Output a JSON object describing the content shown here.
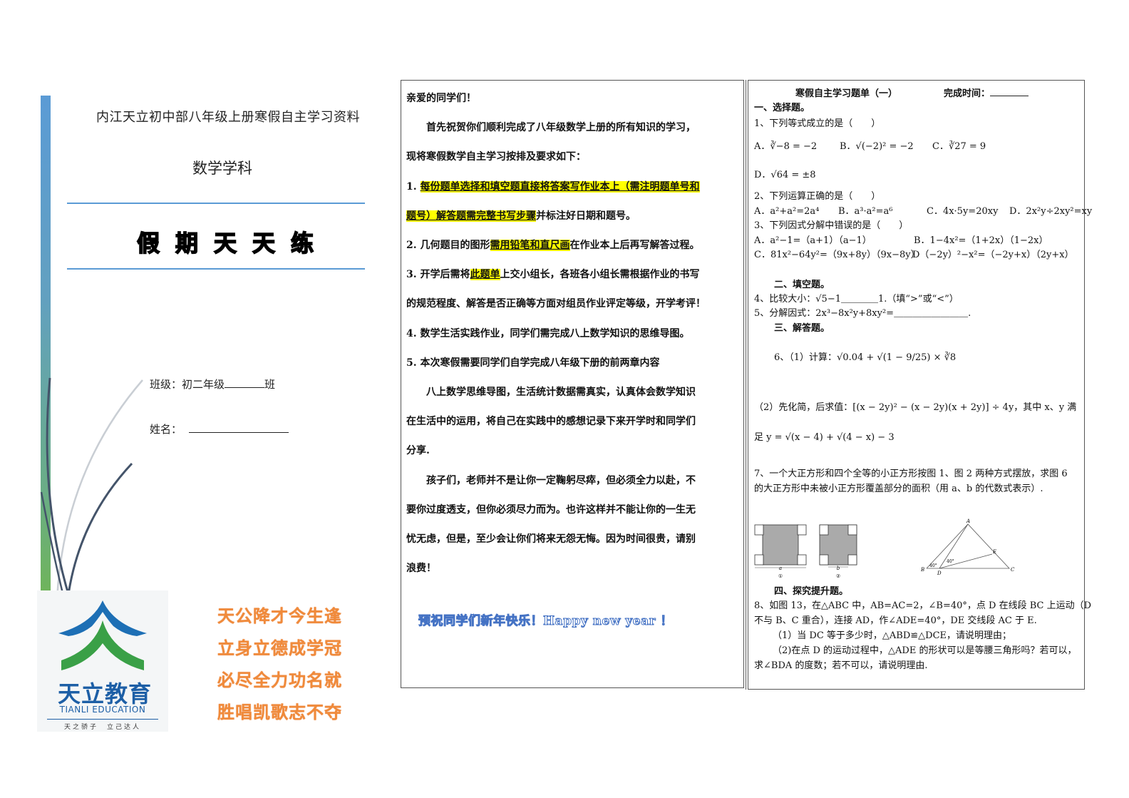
{
  "cover": {
    "title": "内江天立初中部八年级上册寒假自主学习资料",
    "subject": "数学学科",
    "banner": "假期天天练",
    "class_label": "班级：初二年级",
    "class_suffix": "班",
    "name_label": "姓名：",
    "logo": {
      "cn": "天立教育",
      "en": "TIANLI EDUCATION",
      "motto": "天之骄子　立己达人",
      "brand_blue": "#1d5fa6",
      "brand_green": "#3a9a3a"
    },
    "poem": [
      "天公降才今生逢",
      "立身立德成学冠",
      "必尽全力功名就",
      "胜唱凯歌志不夺"
    ],
    "poem_color": "#f08a3a"
  },
  "letter": {
    "salutation": "亲爱的同学们！",
    "intro_1": "首先祝贺你们顺利完成了八年级数学上册的所有知识的学习，",
    "intro_2": "现将寒假数学自主学习按排及要求如下：",
    "item1_num": "1. ",
    "item1_hl1": "每份题单选择和填空题直接将答案写作业本上（需注明题单号和",
    "item1_hl2": "题号）解答题需完整书写步骤",
    "item1_rest": "并标注好日期和题号。",
    "item2_pre": "2. 几何题目的图形",
    "item2_hl": "需用铅笔和直尺画",
    "item2_rest": "在作业本上后再写解答过程。",
    "item3_pre": "3. 开学后需将",
    "item3_hl": "此题单",
    "item3_rest": "上交小组长，各班各小组长需根据作业的书写",
    "item3_line2": "的规范程度、解答是否正确等方面对组员作业评定等级，开学考评！",
    "item4": "4. 数学生活实践作业，同学们需完成八上数学知识的思维导图。",
    "item5": "5. 本次寒假需要同学们自学完成八年级下册的前两章内容",
    "para2_1": "八上数学思维导图，生活统计数据需真实，认真体会数学知识",
    "para2_2": "在生活中的运用，将自己在实践中的感想记录下来开学时和同学们",
    "para2_3": "分享.",
    "para3_1": "孩子们，老师并不是让你一定鞠躬尽瘁，但必须全力以赴，不",
    "para3_2": "要你过度透支，但你必须尽力而为。也许这样并不能让你的一生无",
    "para3_3": "忧无虑，但是，至少会让你们将来无怨无悔。因为时间很贵，请别",
    "para3_4": "浪费！",
    "greeting": "预祝同学们新年快乐！Happy  new  year  ！",
    "highlight_color": "#ffff00",
    "greeting_color": "#4472c4"
  },
  "sheet": {
    "title": "寒假自主学习题单（一）",
    "time_label": "完成时间：",
    "sec1": "一、选择题。",
    "q1": "1、下列等式成立的是（　　）",
    "q1_options": [
      "A．∛−8 = −2",
      "B．√(−2)² = −2",
      "C．∛27 = 9",
      "D．√64 = ±8"
    ],
    "q2": "2、下列运算正确的是（　　）",
    "q2_options": [
      "A．a²+a²=2a⁴",
      "B．a³·a²=a⁶",
      "C．4x·5y=20xy",
      "D．2x²y÷2xy²=xy"
    ],
    "q3": "3、下列因式分解中错误的是（　　）",
    "q3_options": [
      "A．a²−1=（a+1）（a−1）",
      "B．1−4x²=（1+2x）（1−2x）",
      "C．81x²−64y²=（9x+8y）（9x−8y）",
      "D（−2y）²−x²=（−2y+x）（2y+x）"
    ],
    "sec2": "二、填空题。",
    "q4": "4、比较大小：√5−1＿＿＿＿1.（填“>”或“<”）",
    "q5": "5、分解因式：2x³−8x²y+8xy²=＿＿＿＿＿＿＿＿.",
    "sec3": "三、解答题。",
    "q6_1": "6、（1）计算：√0.04 + √(1 − 9/25) × ∛8",
    "q6_2a": "（2）先化简，后求值：[(x − 2y)² − (x − 2y)(x + 2y)] ÷ 4y，其中 x、y 满",
    "q6_2b": "足 y = √(x − 4) + √(4 − x) − 3",
    "q7a": "7、一个大正方形和四个全等的小正方形按图 1、图 2 两种方式摆放，求图 6",
    "q7b": "的大正方形中未被小正方形覆盖部分的面积（用 a、b 的代数式表示）.",
    "fig1_label": "a",
    "fig1_caption": "①",
    "fig2_label": "b",
    "fig2_caption": "②",
    "tri_labels": {
      "A": "A",
      "B": "B",
      "C": "C",
      "D": "D",
      "E": "E",
      "angle1": "40°",
      "angle2": "40°"
    },
    "sec4": "四、探究提升题。",
    "q8a": "8、如图 13，在△ABC 中，AB=AC=2，∠B=40°，点 D 在线段 BC 上运动（D",
    "q8b": "不与 B、C 重合），连接 AD，作∠ADE=40°，DE 交线段 AC 于 E.",
    "q8c": "（1）当 DC 等于多少时，△ABD≌△DCE，请说明理由；",
    "q8d": "（2)在点 D 的运动过程中，△ADE 的形状可以是等腰三角形吗？若可以，",
    "q8e": "求∠BDA 的度数；若不可以，请说明理由."
  }
}
